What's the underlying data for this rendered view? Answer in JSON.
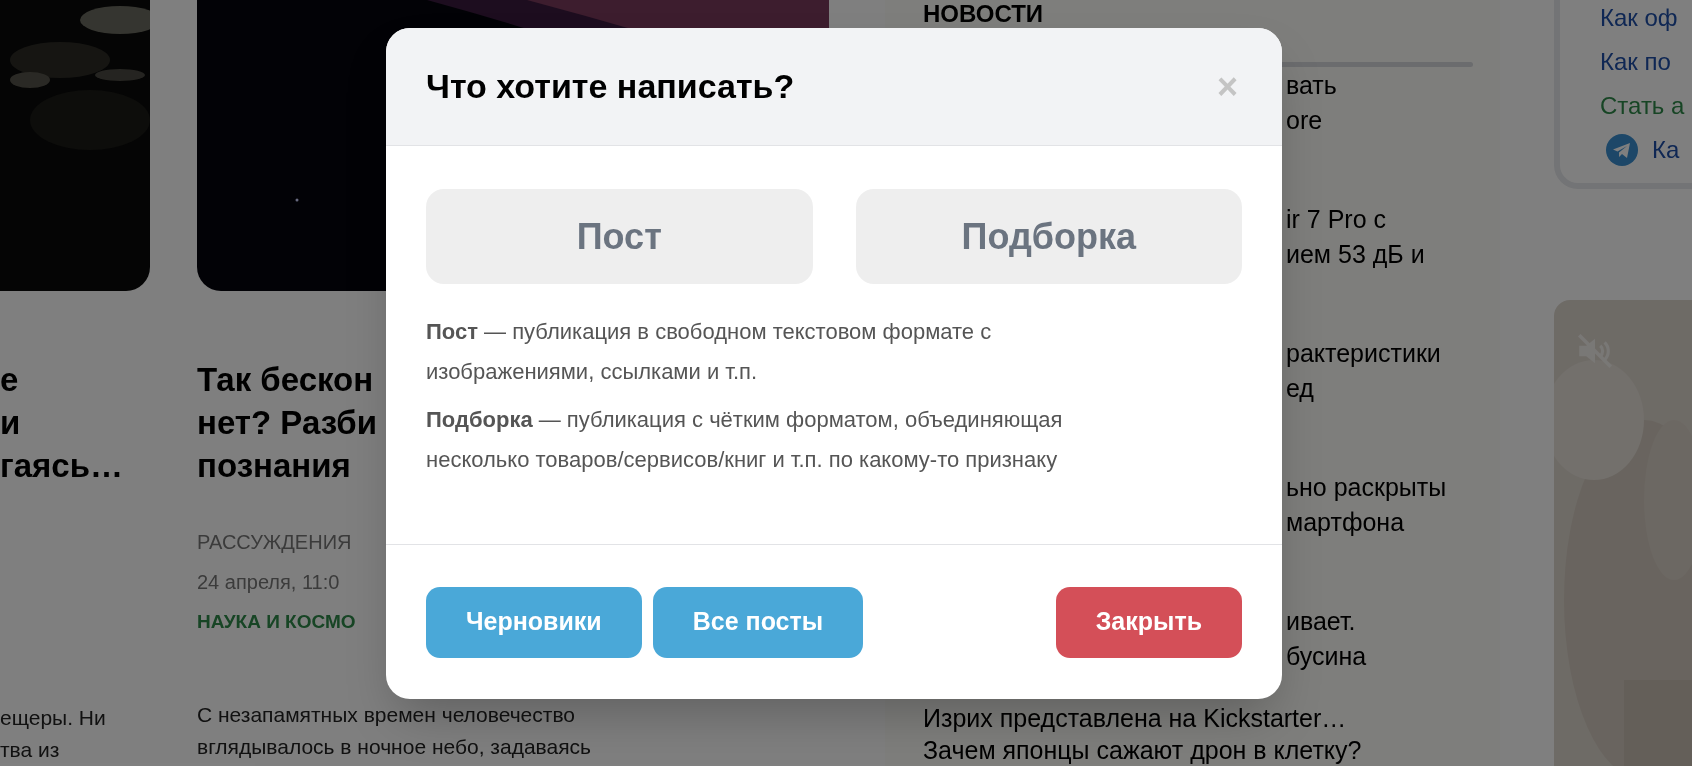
{
  "feed": {
    "cards": [
      {
        "title_lines": [
          "е",
          "и",
          "гаясь…"
        ],
        "excerpt_lines": [
          "ещеры. Ни",
          "тва из"
        ]
      },
      {
        "title_lines": [
          "Так бескон",
          "нет? Разби",
          "познания"
        ],
        "category": "РАССУЖДЕНИЯ",
        "date": "24 апреля, 11:0",
        "tag": "НАУКА И КОСМО",
        "excerpt_lines": [
          "С незапамятных времен человечество",
          "вглядывалось в ночное небо, задаваясь"
        ]
      }
    ]
  },
  "news": {
    "heading": "НОВОСТИ",
    "items": [
      {
        "lines": [
          "вать",
          "ore"
        ]
      },
      {
        "lines": [
          "ir 7 Pro с",
          "ием 53 дБ и"
        ]
      },
      {
        "lines": [
          "рактеристики",
          "ед"
        ]
      },
      {
        "lines": [
          "ьно раскрыты",
          "мартфона"
        ]
      },
      {
        "lines": [
          "ивает.",
          "бусина"
        ]
      }
    ],
    "below": [
      "Изрих представлена на Kickstarter…",
      "Зачем японцы сажают дрон в клетку?"
    ]
  },
  "sidebar": {
    "links": [
      {
        "text": "Как оф",
        "kind": "link"
      },
      {
        "text": "Как по",
        "kind": "link"
      },
      {
        "text": "Стать а",
        "kind": "accent"
      },
      {
        "text": "Ка",
        "kind": "telegram"
      }
    ]
  },
  "video": {
    "muted": true
  },
  "dialog": {
    "title": "Что хотите написать?",
    "close": "×",
    "options": [
      {
        "label": "Пост"
      },
      {
        "label": "Подборка"
      }
    ],
    "descriptions": [
      "**Пост** — публикация в свободном текстовом формате с изображениями, ссылками и т.п.",
      "**Подборка** — публикация с чётким форматом, объединяющая несколько товаров/сервисов/книг и т.п. по какому-то признаку"
    ],
    "buttons": [
      {
        "label": "Черновики",
        "kind": "secondary"
      },
      {
        "label": "Все посты",
        "kind": "secondary"
      },
      {
        "label": "Закрыть",
        "kind": "danger"
      }
    ]
  }
}
